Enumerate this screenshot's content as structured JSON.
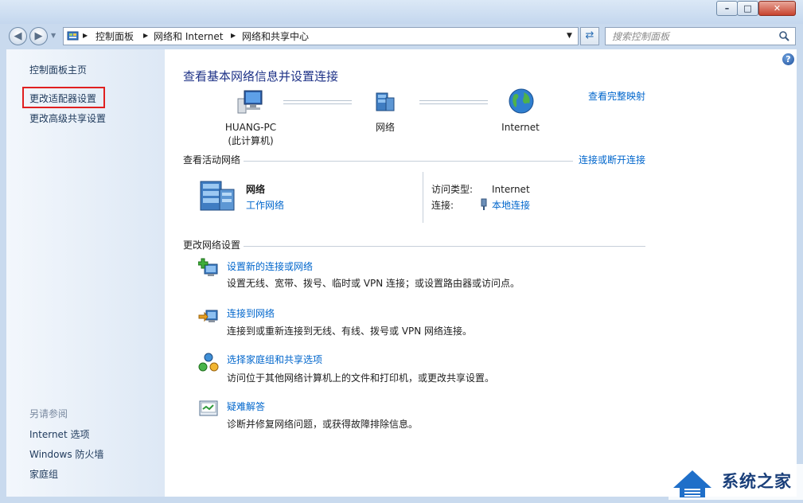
{
  "window": {
    "caption_buttons": {
      "minimize": "–",
      "maximize": "□",
      "close": "✕"
    }
  },
  "nav": {
    "breadcrumbs": [
      "控制面板",
      "网络和 Internet",
      "网络和共享中心"
    ],
    "search_placeholder": "搜索控制面板"
  },
  "sidebar": {
    "items": [
      {
        "label": "控制面板主页"
      },
      {
        "label": "更改适配器设置",
        "highlighted": true
      },
      {
        "label": "更改高级共享设置"
      }
    ],
    "see_also_title": "另请参阅",
    "see_also": [
      {
        "label": "Internet 选项"
      },
      {
        "label": "Windows 防火墙"
      },
      {
        "label": "家庭组"
      }
    ]
  },
  "main": {
    "title": "查看基本网络信息并设置连接",
    "full_map_link": "查看完整映射",
    "map": {
      "computer_name": "HUANG-PC",
      "computer_sub": "(此计算机)",
      "network": "网络",
      "internet": "Internet"
    },
    "active": {
      "section_title": "查看活动网络",
      "connect_link": "连接或断开连接",
      "network_name": "网络",
      "network_type": "工作网络",
      "access_label": "访问类型:",
      "access_value": "Internet",
      "conn_label": "连接:",
      "conn_value": "本地连接"
    },
    "change": {
      "section_title": "更改网络设置",
      "tasks": [
        {
          "title": "设置新的连接或网络",
          "desc": "设置无线、宽带、拨号、临时或 VPN 连接；或设置路由器或访问点。"
        },
        {
          "title": "连接到网络",
          "desc": "连接到或重新连接到无线、有线、拨号或 VPN 网络连接。"
        },
        {
          "title": "选择家庭组和共享选项",
          "desc": "访问位于其他网络计算机上的文件和打印机，或更改共享设置。"
        },
        {
          "title": "疑难解答",
          "desc": "诊断并修复网络问题，或获得故障排除信息。"
        }
      ]
    }
  },
  "watermark": {
    "text": "系统之家"
  },
  "colors": {
    "link": "#0066cc",
    "heading": "#1e3287",
    "highlight_box": "#e02020"
  }
}
